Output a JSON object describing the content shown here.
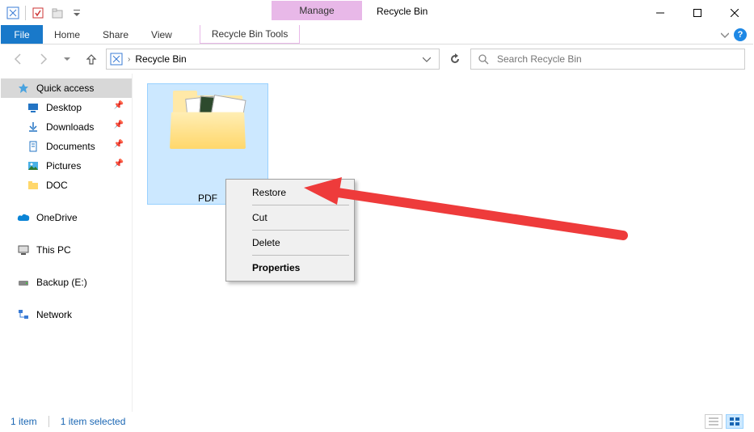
{
  "title": "Recycle Bin",
  "manage_tab_label": "Manage",
  "ribbon": {
    "file": "File",
    "tabs": [
      "Home",
      "Share",
      "View"
    ],
    "tool_tab": "Recycle Bin Tools"
  },
  "breadcrumb": {
    "current": "Recycle Bin"
  },
  "search": {
    "placeholder": "Search Recycle Bin"
  },
  "sidebar": {
    "quick_access": "Quick access",
    "items": [
      {
        "label": "Desktop",
        "pin": true
      },
      {
        "label": "Downloads",
        "pin": true
      },
      {
        "label": "Documents",
        "pin": true
      },
      {
        "label": "Pictures",
        "pin": true
      },
      {
        "label": "DOC",
        "pin": false
      }
    ],
    "onedrive": "OneDrive",
    "thispc": "This PC",
    "drive": "Backup (E:)",
    "network": "Network"
  },
  "content": {
    "items": [
      {
        "label": "PDF"
      }
    ]
  },
  "context_menu": {
    "restore": "Restore",
    "cut": "Cut",
    "delete": "Delete",
    "properties": "Properties"
  },
  "statusbar": {
    "count": "1 item",
    "selected": "1 item selected"
  }
}
